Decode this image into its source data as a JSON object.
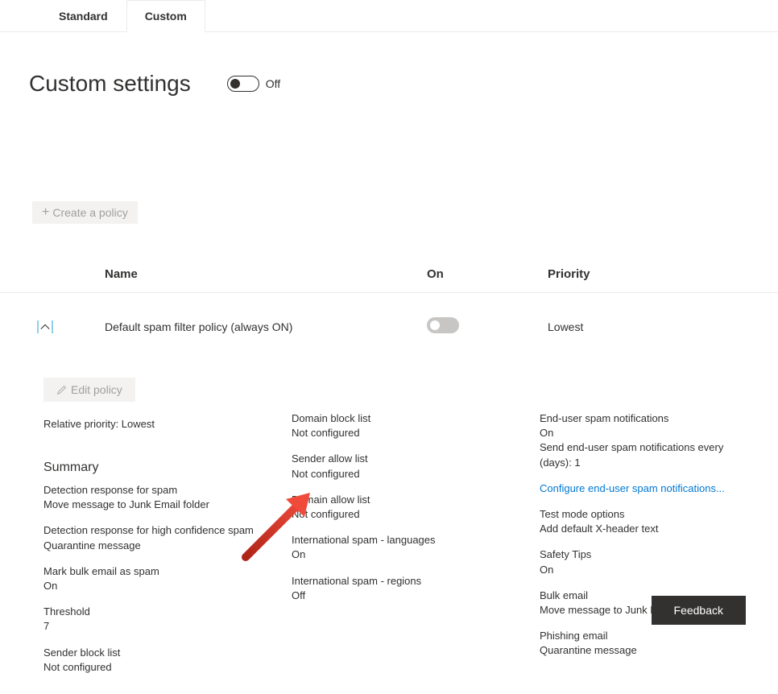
{
  "tabs": {
    "standard": "Standard",
    "custom": "Custom"
  },
  "header": {
    "title": "Custom settings",
    "toggle_state": "Off"
  },
  "actions": {
    "create_policy": "Create a policy"
  },
  "table": {
    "headers": {
      "name": "Name",
      "on": "On",
      "priority": "Priority"
    },
    "row": {
      "name": "Default spam filter policy (always ON)",
      "priority": "Lowest"
    }
  },
  "detail": {
    "edit_policy": "Edit policy",
    "relative_priority": "Relative priority: Lowest",
    "summary_heading": "Summary",
    "col1": {
      "b1_label": "Detection response for spam",
      "b1_value": "Move message to Junk Email folder",
      "b2_label": "Detection response for high confidence spam",
      "b2_value": "Quarantine message",
      "b3_label": "Mark bulk email as spam",
      "b3_value": "On",
      "b4_label": "Threshold",
      "b4_value": "7",
      "b5_label": "Sender block list",
      "b5_value": "Not configured"
    },
    "col2": {
      "b1_label": "Domain block list",
      "b1_value": "Not configured",
      "b2_label": "Sender allow list",
      "b2_value": "Not configured",
      "b3_label": "Domain allow list",
      "b3_value": "Not configured",
      "b4_label": "International spam - languages",
      "b4_value": "On",
      "b5_label": "International spam - regions",
      "b5_value": "Off"
    },
    "col3": {
      "b1_label": "End-user spam notifications",
      "b1_value": "On",
      "b1_extra": "Send end-user spam notifications every (days): 1",
      "link": "Configure end-user spam notifications...",
      "b2_label": "Test mode options",
      "b2_value": "Add default X-header text",
      "b3_label": "Safety Tips",
      "b3_value": "On",
      "b4_label": "Bulk email",
      "b4_value": "Move message to Junk Email folder",
      "b5_label": "Phishing email",
      "b5_value": "Quarantine message"
    }
  },
  "feedback": "Feedback"
}
